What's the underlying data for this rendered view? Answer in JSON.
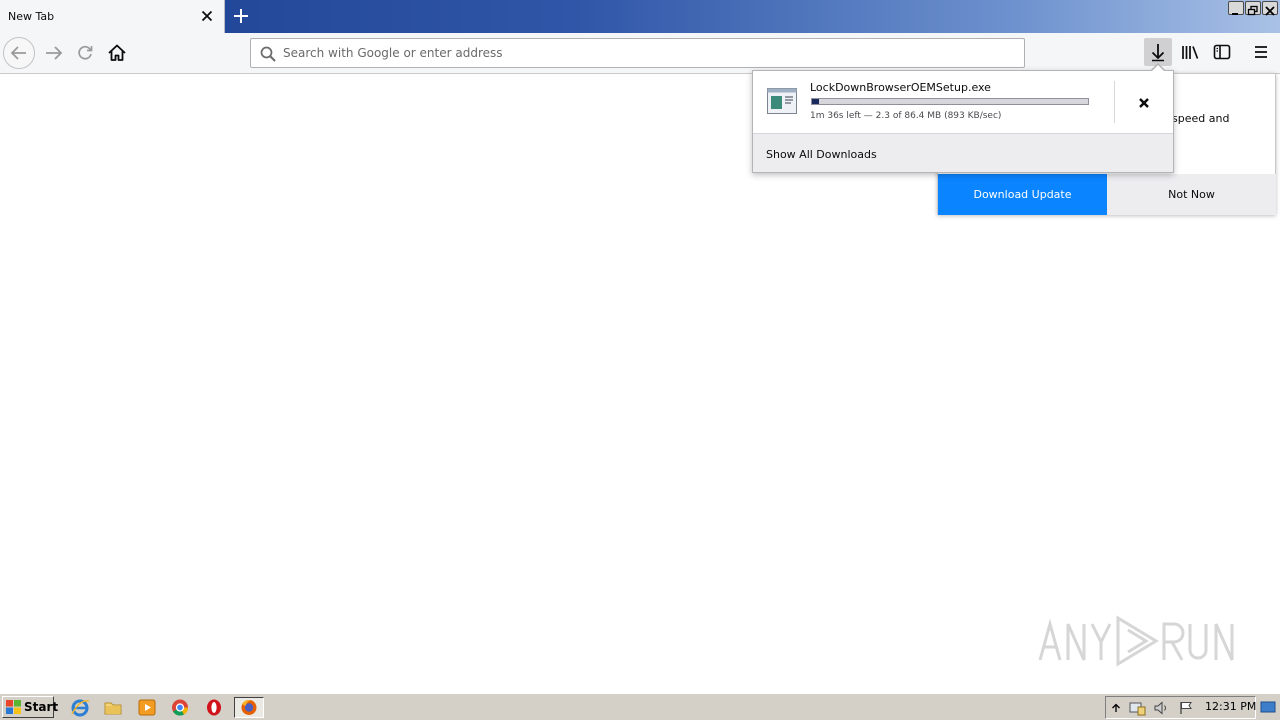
{
  "browser": {
    "tab": {
      "title": "New Tab"
    },
    "urlbar": {
      "placeholder": "Search with Google or enter address"
    }
  },
  "downloads_panel": {
    "item": {
      "filename": "LockDownBrowserOEMSetup.exe",
      "status": "1m 36s left — 2.3 of 86.4 MB (893 KB/sec)",
      "progress_fraction": 0.027
    },
    "show_all_label": "Show All Downloads"
  },
  "update_notification": {
    "partial_text": "speed and",
    "accept_label": "Download Update",
    "decline_label": "Not Now",
    "accent_color": "#0a84ff"
  },
  "watermark": {
    "text": "ANY RUN"
  },
  "taskbar": {
    "start_label": "Start",
    "clock": "12:31 PM",
    "apps": [
      "internet-explorer-icon",
      "folder-icon",
      "media-player-icon",
      "chrome-icon",
      "opera-icon",
      "firefox-icon"
    ]
  }
}
